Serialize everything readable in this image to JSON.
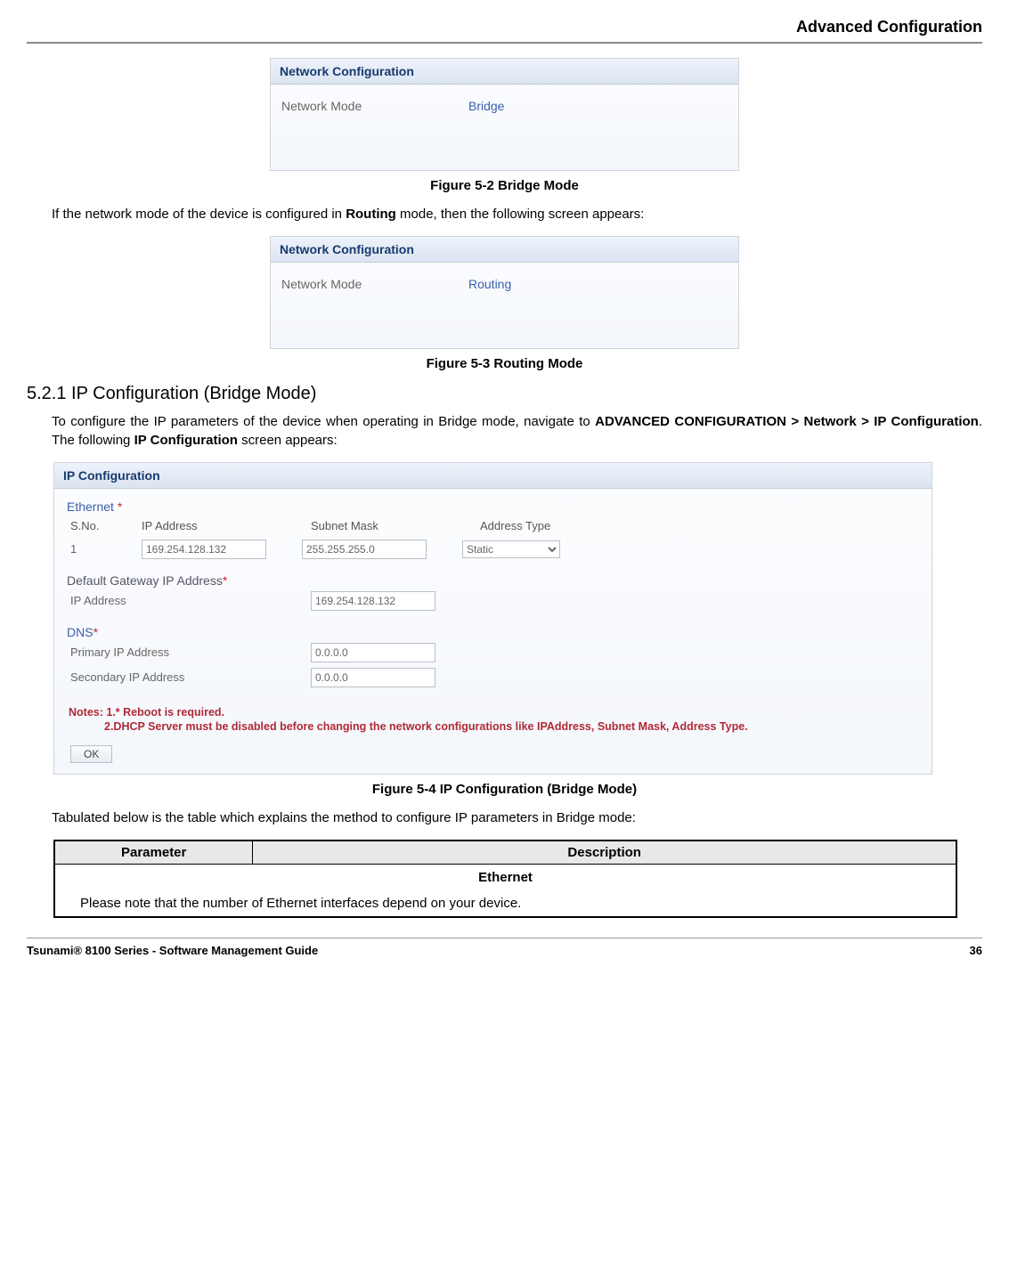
{
  "header": {
    "title": "Advanced Configuration"
  },
  "fig52": {
    "panel_title": "Network Configuration",
    "label": "Network Mode",
    "value": "Bridge",
    "caption": "Figure 5-2 Bridge Mode"
  },
  "intro_routing": {
    "pre": "If the network mode of the device is configured in ",
    "bold": "Routing",
    "post": " mode, then the following screen appears:"
  },
  "fig53": {
    "panel_title": "Network Configuration",
    "label": "Network Mode",
    "value": "Routing",
    "caption": "Figure 5-3 Routing Mode"
  },
  "section": {
    "heading": "5.2.1 IP Configuration (Bridge Mode)"
  },
  "intro_ipcfg": {
    "t1": "To configure the IP parameters of the device when operating in Bridge mode, navigate to ",
    "b1": "ADVANCED CONFIGURATION > Network > IP Configuration",
    "t2": ". The following ",
    "b2": "IP Configuration",
    "t3": " screen appears:"
  },
  "ipcfg": {
    "panel_title": "IP Configuration",
    "ethernet_label": "Ethernet ",
    "cols": {
      "sno": "S.No.",
      "ip": "IP Address",
      "mask": "Subnet Mask",
      "type": "Address Type"
    },
    "row1": {
      "sno": "1",
      "ip": "169.254.128.132",
      "mask": "255.255.255.0",
      "type": "Static"
    },
    "gateway_section": "Default Gateway IP Address",
    "gateway_label": "IP Address",
    "gateway_value": "169.254.128.132",
    "dns_section": "DNS",
    "dns_primary_label": "Primary IP Address",
    "dns_primary_value": "0.0.0.0",
    "dns_secondary_label": "Secondary IP Address",
    "dns_secondary_value": "0.0.0.0",
    "note1": "Notes: 1.* Reboot is required.",
    "note2": "2.DHCP Server must be disabled before changing the network configurations like IPAddress, Subnet Mask, Address Type.",
    "ok": "OK",
    "caption": "Figure 5-4 IP Configuration (Bridge Mode)"
  },
  "tab_intro": "Tabulated below is the table which explains the method to configure IP parameters in Bridge mode:",
  "table": {
    "h_param": "Parameter",
    "h_desc": "Description",
    "eth": "Ethernet",
    "eth_note": "Please note that the number of Ethernet interfaces depend on your device."
  },
  "footer": {
    "left": "Tsunami® 8100 Series - Software Management Guide",
    "right": "36"
  }
}
